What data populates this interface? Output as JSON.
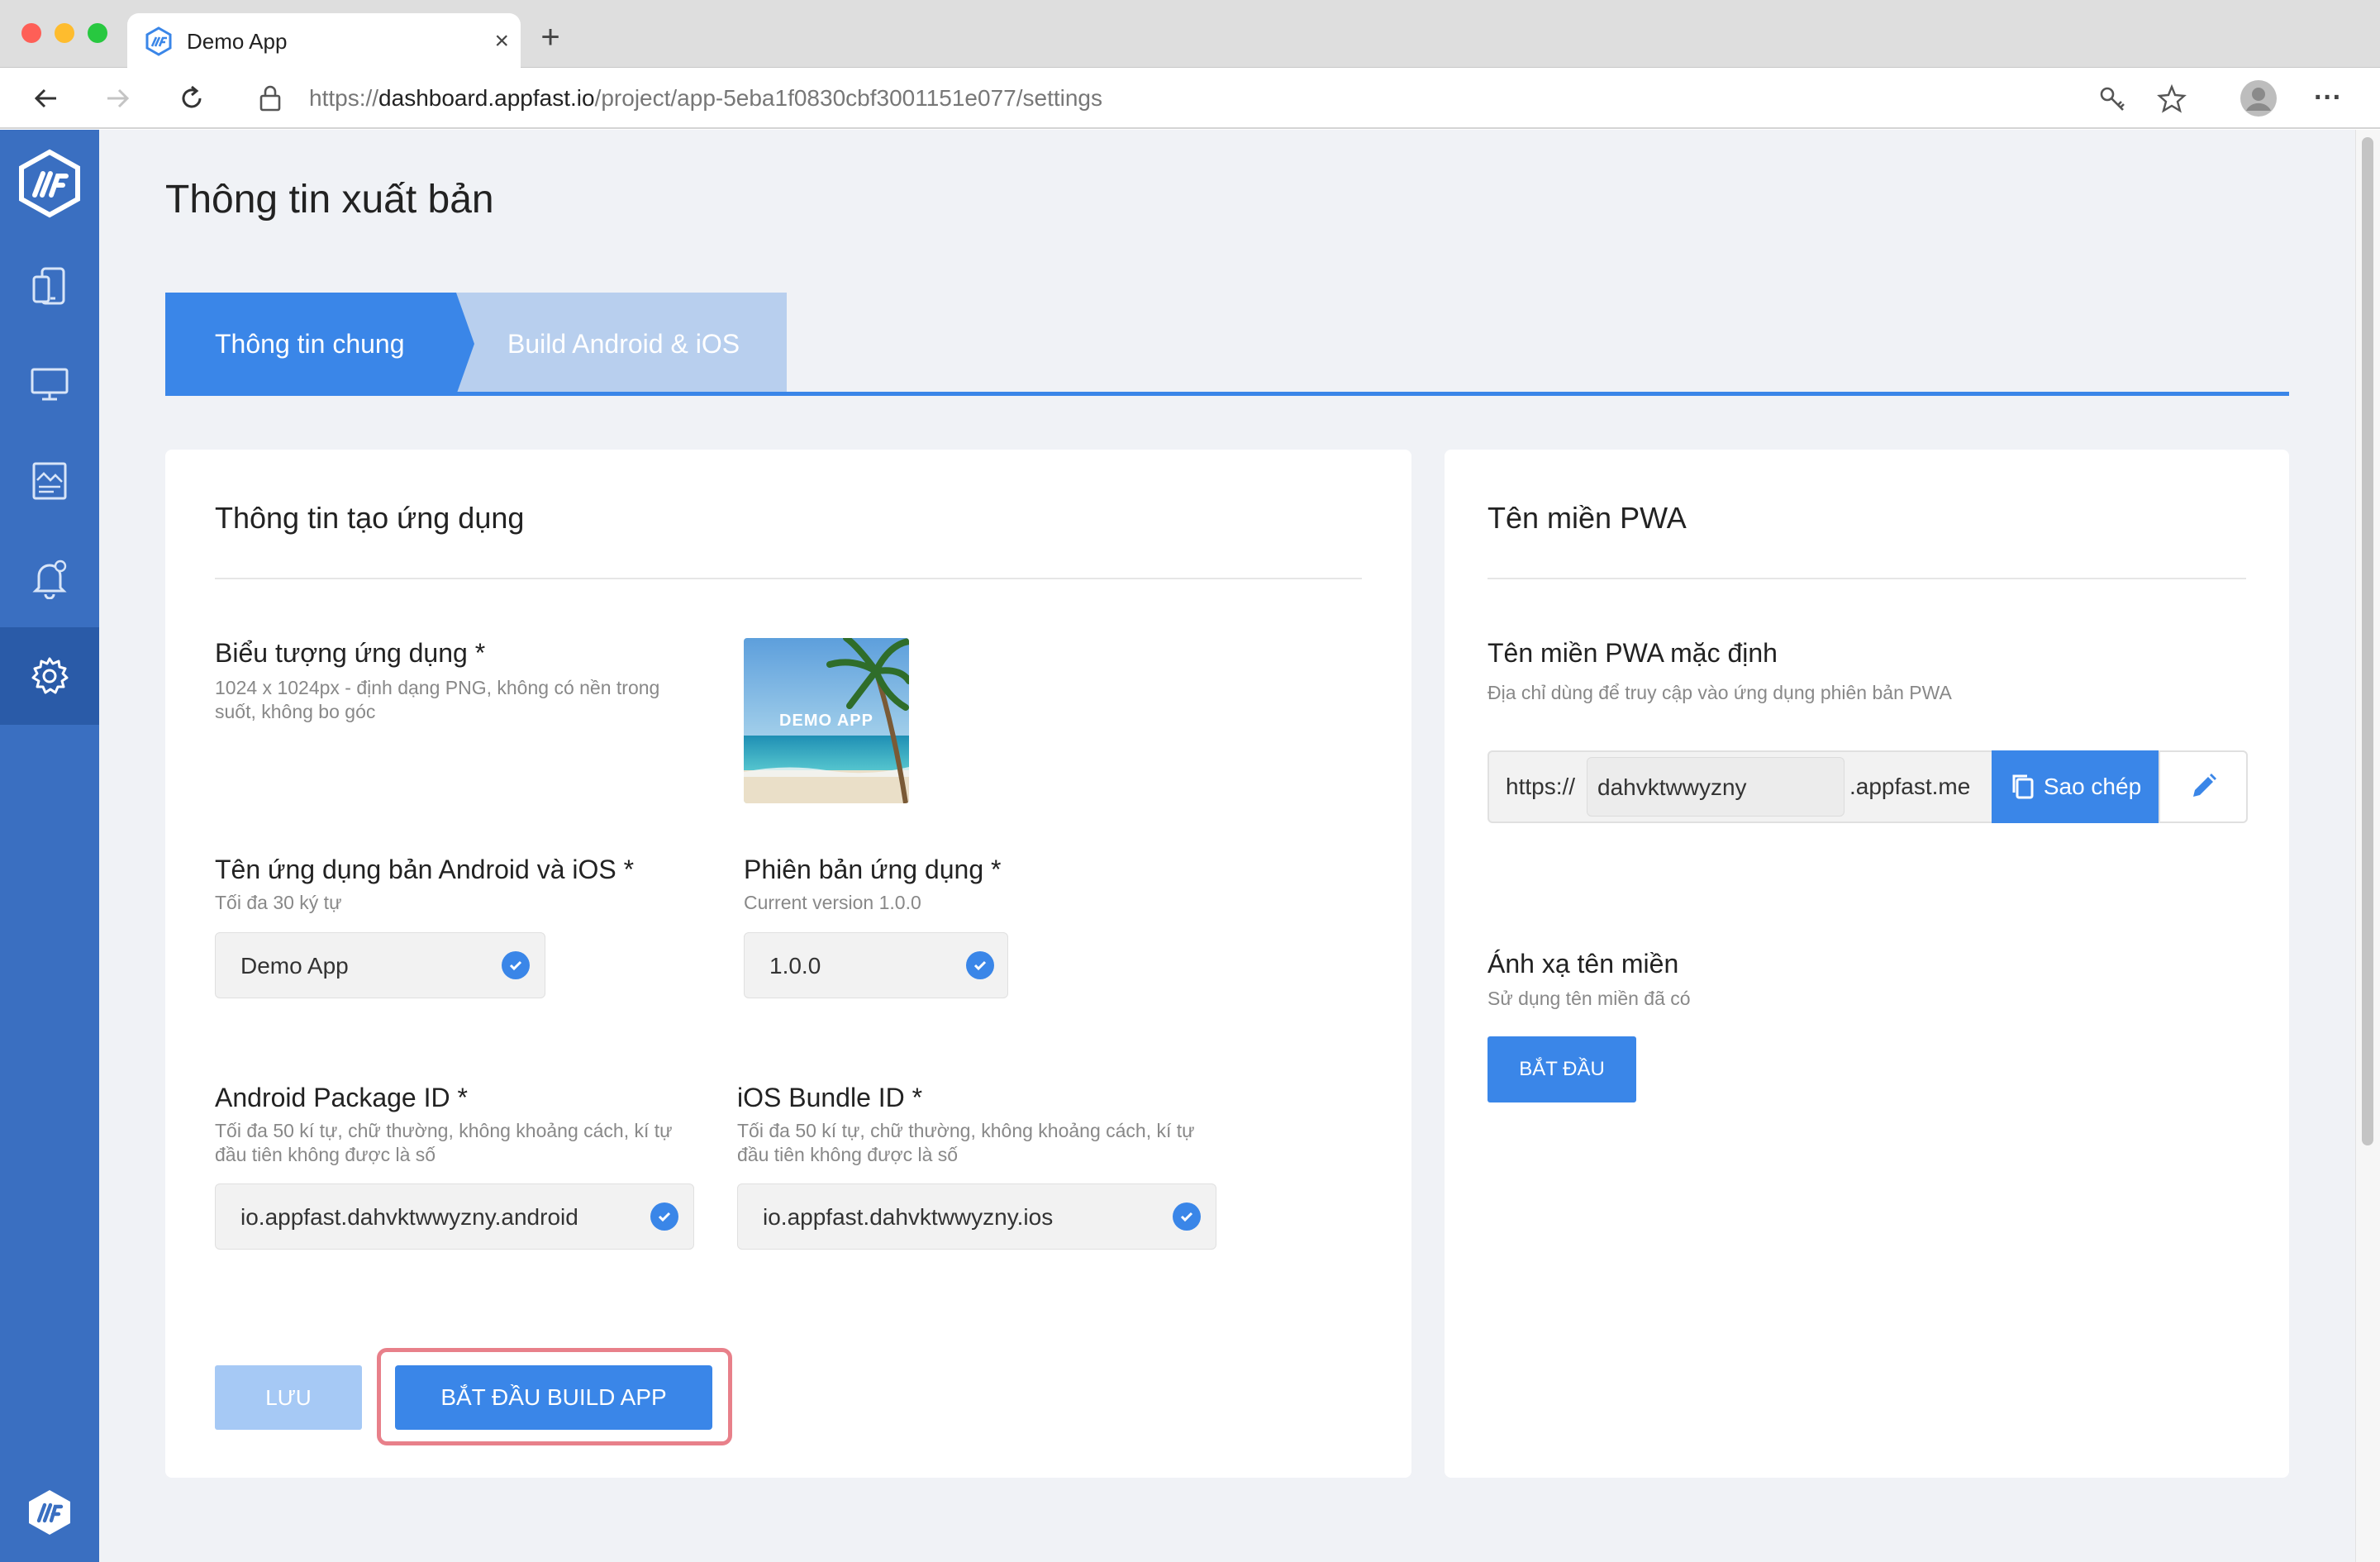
{
  "browser": {
    "tab_title": "Demo App",
    "tab_close": "×",
    "new_tab": "+",
    "url_scheme": "https://",
    "url_host": "dashboard.appfast.io",
    "url_path": "/project/app-5eba1f0830cbf3001151e077/settings",
    "menu": "···"
  },
  "page": {
    "title": "Thông tin xuất bản"
  },
  "tabs": [
    {
      "label": "Thông tin chung",
      "active": true
    },
    {
      "label": "Build Android & iOS",
      "active": false
    }
  ],
  "app_info": {
    "title": "Thông tin tạo ứng dụng",
    "icon": {
      "label": "Biểu tượng ứng dụng *",
      "hint": "1024 x 1024px - định dạng PNG, không có nền trong suốt, không bo góc",
      "image_caption": "DEMO APP"
    },
    "app_name": {
      "label": "Tên ứng dụng bản Android và iOS *",
      "hint": "Tối đa 30 ký tự",
      "value": "Demo App"
    },
    "version": {
      "label": "Phiên bản ứng dụng *",
      "hint": "Current version 1.0.0",
      "value": "1.0.0"
    },
    "android_id": {
      "label": "Android Package ID *",
      "hint": "Tối đa 50 kí tự, chữ thường, không khoảng cách, kí tự đầu tiên không được là số",
      "value": "io.appfast.dahvktwwyzny.android"
    },
    "ios_id": {
      "label": "iOS Bundle ID *",
      "hint": "Tối đa 50 kí tự, chữ thường, không khoảng cách, kí tự đầu tiên không được là số",
      "value": "io.appfast.dahvktwwyzny.ios"
    },
    "save_label": "LƯU",
    "build_label": "BẮT ĐẦU BUILD APP"
  },
  "pwa": {
    "title": "Tên miền PWA",
    "default_label": "Tên miền PWA mặc định",
    "default_hint": "Địa chỉ dùng để truy cập vào ứng dụng phiên bản PWA",
    "prefix": "https://",
    "subdomain": "dahvktwwyzny",
    "suffix": ".appfast.me",
    "copy_label": "Sao chép",
    "map_label": "Ánh xạ tên miền",
    "map_hint": "Sử dụng tên miền đã có",
    "start_label": "BẮT ĐẦU"
  },
  "colors": {
    "accent": "#3a86e8",
    "sidebar": "#3a6fc1",
    "sidebar_active": "#2a5ba8",
    "highlight_ring": "#e8808a",
    "page_bg": "#f0f2f6"
  },
  "sidebar_icons": [
    "appfast-logo-icon",
    "devices-icon",
    "desktop-icon",
    "image-layout-icon",
    "notification-bell-icon",
    "settings-gear-icon",
    "appfast-footer-logo-icon"
  ]
}
